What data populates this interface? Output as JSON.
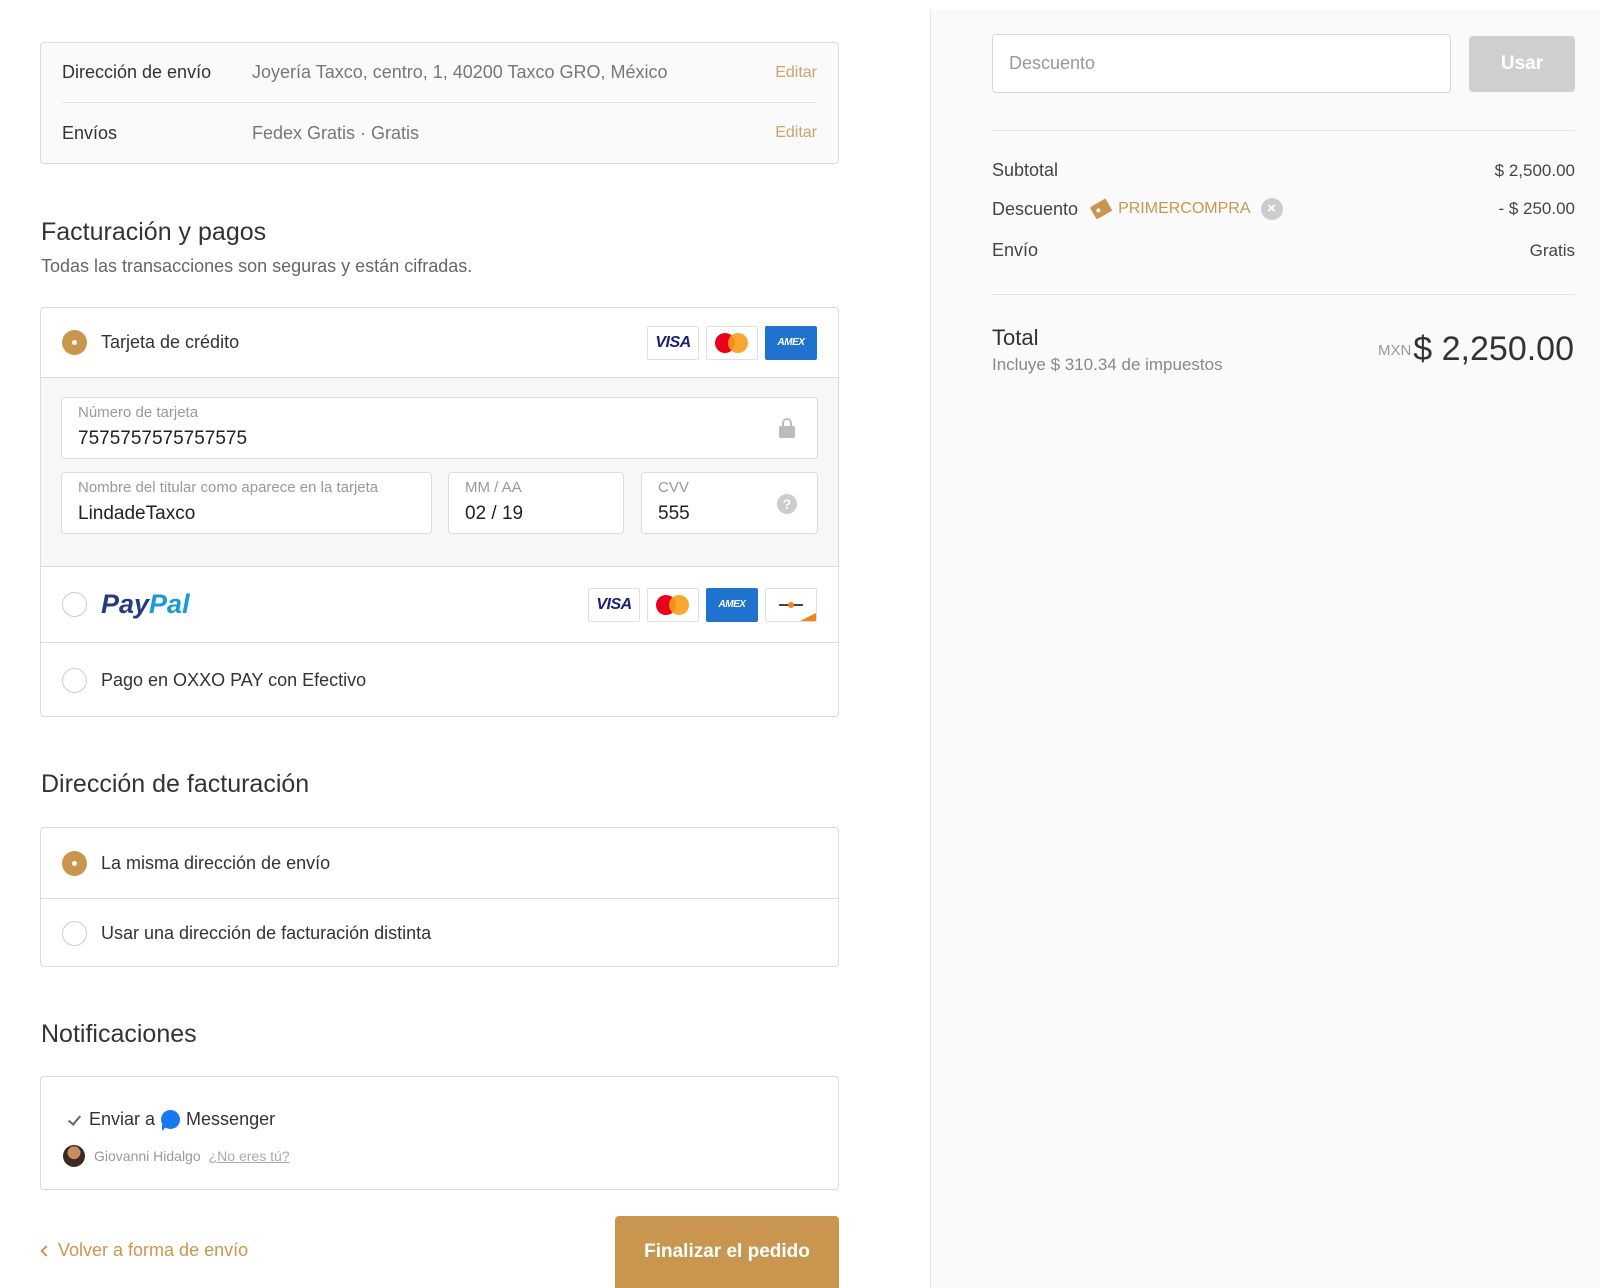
{
  "summary": {
    "address_label": "Dirección de envío",
    "address_value": "Joyería Taxco, centro, 1, 40200 Taxco GRO, México",
    "address_edit": "Editar",
    "shipping_label": "Envíos",
    "shipping_value": "Fedex Gratis · Gratis",
    "shipping_edit": "Editar"
  },
  "billing_payments": {
    "title": "Facturación y pagos",
    "subtitle": "Todas las transacciones son seguras y están cifradas.",
    "credit_card": {
      "label": "Tarjeta de crédito",
      "selected": true,
      "card_icons": [
        "visa-icon",
        "mastercard-icon",
        "amex-icon"
      ],
      "visa_text": "VISA",
      "amex_text": "AMEX",
      "number_label": "Número de tarjeta",
      "number_value": "7575757575757575",
      "name_label": "Nombre del titular como aparece en la tarjeta",
      "name_value": "LindadeTaxco",
      "expiry_label": "MM / AA",
      "expiry_value": "02 / 19",
      "cvv_label": "CVV",
      "cvv_value": "555",
      "help_glyph": "?"
    },
    "paypal": {
      "label_part1": "Pay",
      "label_part2": "Pal",
      "selected": false,
      "card_icons": [
        "visa-icon",
        "mastercard-icon",
        "amex-icon",
        "discover-icon"
      ]
    },
    "oxxo": {
      "label": "Pago en OXXO PAY con Efectivo",
      "selected": false
    }
  },
  "billing_address": {
    "title": "Dirección de facturación",
    "option_same": "La misma dirección de envío",
    "option_different": "Usar una dirección de facturación distinta",
    "selected": "same"
  },
  "notifications": {
    "title": "Notificaciones",
    "send_to": "Enviar a",
    "messenger": "Messenger",
    "user_name": "Giovanni Hidalgo",
    "not_you": "¿No eres tú?"
  },
  "actions": {
    "back_label": "Volver a forma de envío",
    "finish_label": "Finalizar el pedido"
  },
  "order_summary": {
    "discount_placeholder": "Descuento",
    "apply_button": "Usar",
    "subtotal_label": "Subtotal",
    "subtotal_value": "$ 2,500.00",
    "discount_label": "Descuento",
    "discount_code": "PRIMERCOMPRA",
    "discount_remove_glyph": "×",
    "discount_value": "- $ 250.00",
    "shipping_label": "Envío",
    "shipping_value": "Gratis",
    "total_label": "Total",
    "taxes_note": "Incluye $ 310.34 de impuestos",
    "currency": "MXN",
    "total_value": "$ 2,250.00"
  },
  "colors": {
    "accent": "#c9964f",
    "disabled_button": "#cfcfcf",
    "panel_bg": "#fafafa"
  }
}
